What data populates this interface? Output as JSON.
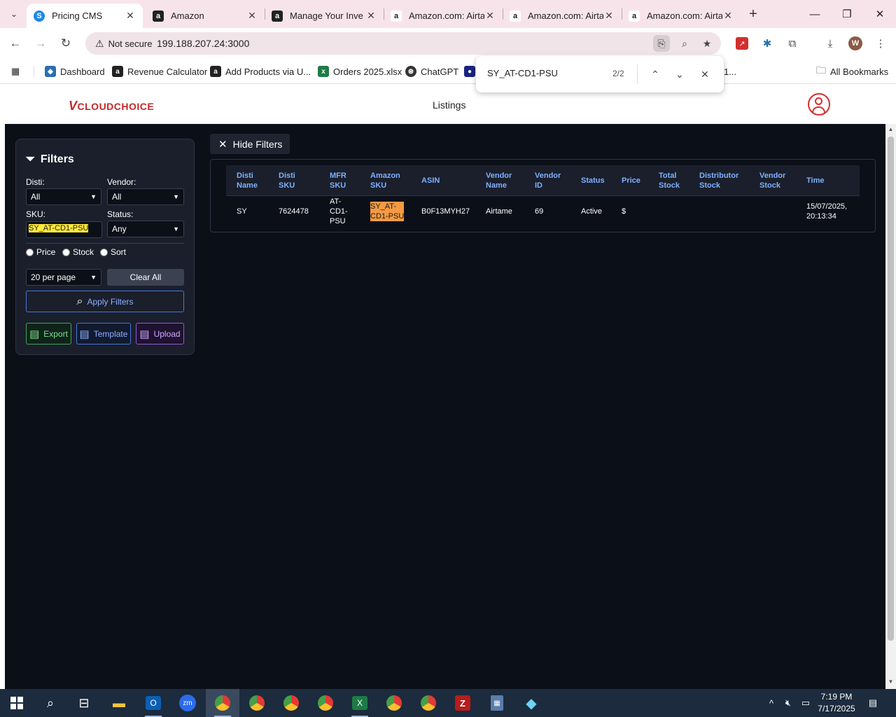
{
  "browser": {
    "tabs": [
      {
        "title": "Pricing CMS",
        "icon": "S",
        "icon_bg": "#1e88e5",
        "active": true
      },
      {
        "title": "Amazon",
        "icon": "a",
        "icon_bg": "#222222",
        "active": false
      },
      {
        "title": "Manage Your Inve",
        "icon": "a",
        "icon_bg": "#222222",
        "active": false
      },
      {
        "title": "Amazon.com: Airta",
        "icon": "a",
        "icon_bg": "#ffffff",
        "active": false
      },
      {
        "title": "Amazon.com: Airta",
        "icon": "a",
        "icon_bg": "#ffffff",
        "active": false
      },
      {
        "title": "Amazon.com: Airta",
        "icon": "a",
        "icon_bg": "#ffffff",
        "active": false
      }
    ],
    "security_label": "Not secure",
    "url": "199.188.207.24:3000",
    "profile_initial": "W",
    "bookmarks": [
      {
        "label": "Dashboard",
        "icon_bg": "#2a6fb0"
      },
      {
        "label": "Revenue Calculator",
        "icon_bg": "#222222"
      },
      {
        "label": "Add Products via U...",
        "icon_bg": "#222222"
      },
      {
        "label": "Orders 2025.xlsx",
        "icon_bg": "#1e7b45"
      },
      {
        "label": "ChatGPT",
        "icon_bg": "#333333"
      },
      {
        "label": "1...",
        "icon_bg": "#ffffff"
      }
    ],
    "all_bookmarks_label": "All Bookmarks"
  },
  "findbar": {
    "query": "SY_AT-CD1-PSU",
    "count": "2/2"
  },
  "app": {
    "logo_v": "V",
    "logo_cloud": "CLOUD",
    "logo_choice": "CHOICE",
    "nav_listings": "Listings"
  },
  "filters": {
    "title": "Filters",
    "disti_label": "Disti:",
    "disti_value": "All",
    "vendor_label": "Vendor:",
    "vendor_value": "All",
    "sku_label": "SKU:",
    "sku_value": "SY_AT-CD1-PSU",
    "status_label": "Status:",
    "status_value": "Any",
    "radio_price": "Price",
    "radio_stock": "Stock",
    "radio_sort": "Sort",
    "per_page": "20 per page",
    "clear_all": "Clear All",
    "apply": "Apply Filters",
    "export": "Export",
    "template": "Template",
    "upload": "Upload"
  },
  "hide_filters": "Hide Filters",
  "table": {
    "headers": [
      [
        "Disti",
        "Name"
      ],
      [
        "Disti",
        "SKU"
      ],
      [
        "MFR",
        "SKU"
      ],
      [
        "Amazon",
        "SKU"
      ],
      [
        "ASIN",
        ""
      ],
      [
        "Vendor",
        "Name"
      ],
      [
        "Vendor",
        "ID"
      ],
      [
        "Status",
        ""
      ],
      [
        "Price",
        ""
      ],
      [
        "Total",
        "Stock"
      ],
      [
        "Distributor",
        "Stock"
      ],
      [
        "Vendor",
        "Stock"
      ],
      [
        "Time",
        ""
      ]
    ],
    "row": {
      "disti_name": "SY",
      "disti_sku": "7624478",
      "mfr_sku": [
        "AT-",
        "CD1-",
        "PSU"
      ],
      "amazon_sku": [
        "SY_AT-",
        "CD1-PSU"
      ],
      "asin": "B0F13MYH27",
      "vendor_name": "Airtame",
      "vendor_id": "69",
      "status": "Active",
      "price": "$",
      "total_stock": "",
      "distributor_stock": "",
      "vendor_stock": "",
      "time": [
        "15/07/2025,",
        "20:13:34"
      ]
    }
  },
  "taskbar": {
    "time": "7:19 PM",
    "date": "7/17/2025"
  }
}
